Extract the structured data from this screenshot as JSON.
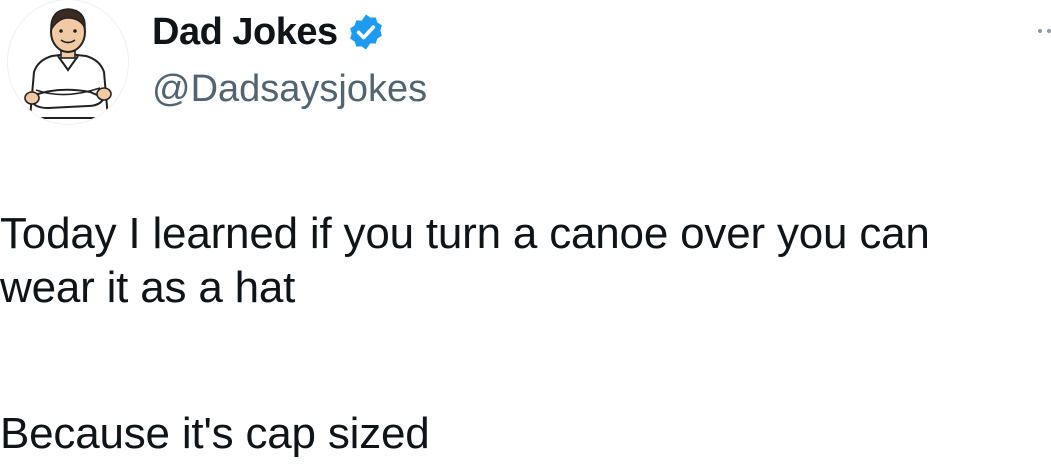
{
  "author": {
    "display_name": "Dad Jokes",
    "handle": "@Dadsaysjokes",
    "verified": true,
    "verified_color": "#1d9bf0",
    "avatar_icon": "cartoon-dad-avatar"
  },
  "tweet": {
    "lines": [
      "Today I learned if you turn a canoe over you can",
      "wear it as a hat",
      "Because it's cap sized"
    ]
  },
  "icons": {
    "more": "more-options-icon",
    "verified": "verified-badge-icon"
  }
}
